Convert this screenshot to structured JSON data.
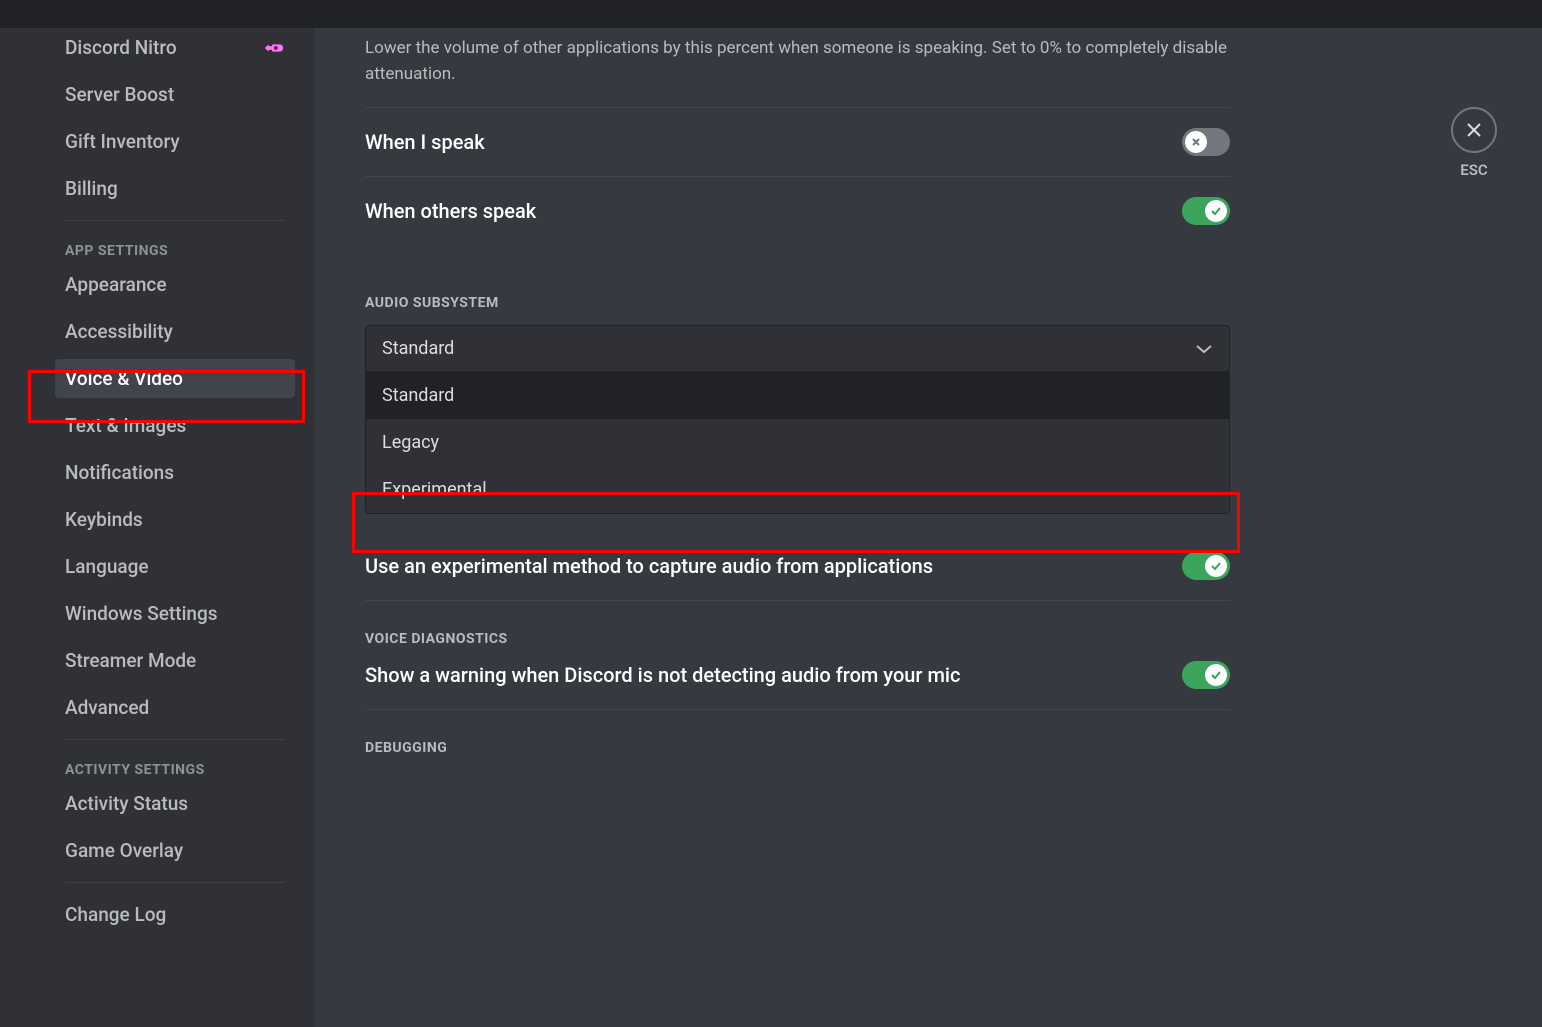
{
  "sidebar": {
    "items_top": [
      {
        "label": "Discord Nitro",
        "has_icon": true
      },
      {
        "label": "Server Boost"
      },
      {
        "label": "Gift Inventory"
      },
      {
        "label": "Billing"
      }
    ],
    "app_settings_header": "APP SETTINGS",
    "app_settings_items": [
      {
        "label": "Appearance"
      },
      {
        "label": "Accessibility"
      },
      {
        "label": "Voice & Video",
        "selected": true
      },
      {
        "label": "Text & Images"
      },
      {
        "label": "Notifications"
      },
      {
        "label": "Keybinds"
      },
      {
        "label": "Language"
      },
      {
        "label": "Windows Settings"
      },
      {
        "label": "Streamer Mode"
      },
      {
        "label": "Advanced"
      }
    ],
    "activity_settings_header": "ACTIVITY SETTINGS",
    "activity_settings_items": [
      {
        "label": "Activity Status"
      },
      {
        "label": "Game Overlay"
      }
    ],
    "bottom_items": [
      {
        "label": "Change Log"
      }
    ]
  },
  "main": {
    "attenuation_description": "Lower the volume of other applications by this percent when someone is speaking. Set to 0% to completely disable attenuation.",
    "when_i_speak": "When I speak",
    "when_others_speak": "When others speak",
    "audio_subsystem_header": "AUDIO SUBSYSTEM",
    "audio_subsystem_selected": "Standard",
    "audio_subsystem_options": [
      {
        "label": "Standard"
      },
      {
        "label": "Legacy"
      },
      {
        "label": "Experimental"
      }
    ],
    "experimental_capture": "Use an experimental method to capture audio from applications",
    "voice_diagnostics_header": "VOICE DIAGNOSTICS",
    "voice_diagnostics_label": "Show a warning when Discord is not detecting audio from your mic",
    "debugging_header": "DEBUGGING"
  },
  "close": {
    "esc_label": "ESC"
  }
}
